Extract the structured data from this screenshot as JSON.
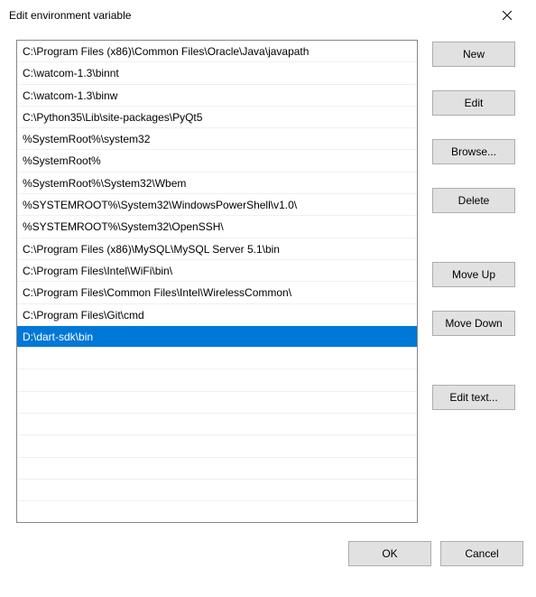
{
  "window": {
    "title": "Edit environment variable"
  },
  "list": {
    "items": [
      "C:\\Program Files (x86)\\Common Files\\Oracle\\Java\\javapath",
      "C:\\watcom-1.3\\binnt",
      "C:\\watcom-1.3\\binw",
      "C:\\Python35\\Lib\\site-packages\\PyQt5",
      "%SystemRoot%\\system32",
      "%SystemRoot%",
      "%SystemRoot%\\System32\\Wbem",
      "%SYSTEMROOT%\\System32\\WindowsPowerShell\\v1.0\\",
      "%SYSTEMROOT%\\System32\\OpenSSH\\",
      "C:\\Program Files (x86)\\MySQL\\MySQL Server 5.1\\bin",
      "C:\\Program Files\\Intel\\WiFi\\bin\\",
      "C:\\Program Files\\Common Files\\Intel\\WirelessCommon\\",
      "C:\\Program Files\\Git\\cmd",
      "D:\\dart-sdk\\bin"
    ],
    "selected_index": 13
  },
  "buttons": {
    "new": "New",
    "edit": "Edit",
    "browse": "Browse...",
    "delete": "Delete",
    "move_up": "Move Up",
    "move_down": "Move Down",
    "edit_text": "Edit text...",
    "ok": "OK",
    "cancel": "Cancel"
  }
}
